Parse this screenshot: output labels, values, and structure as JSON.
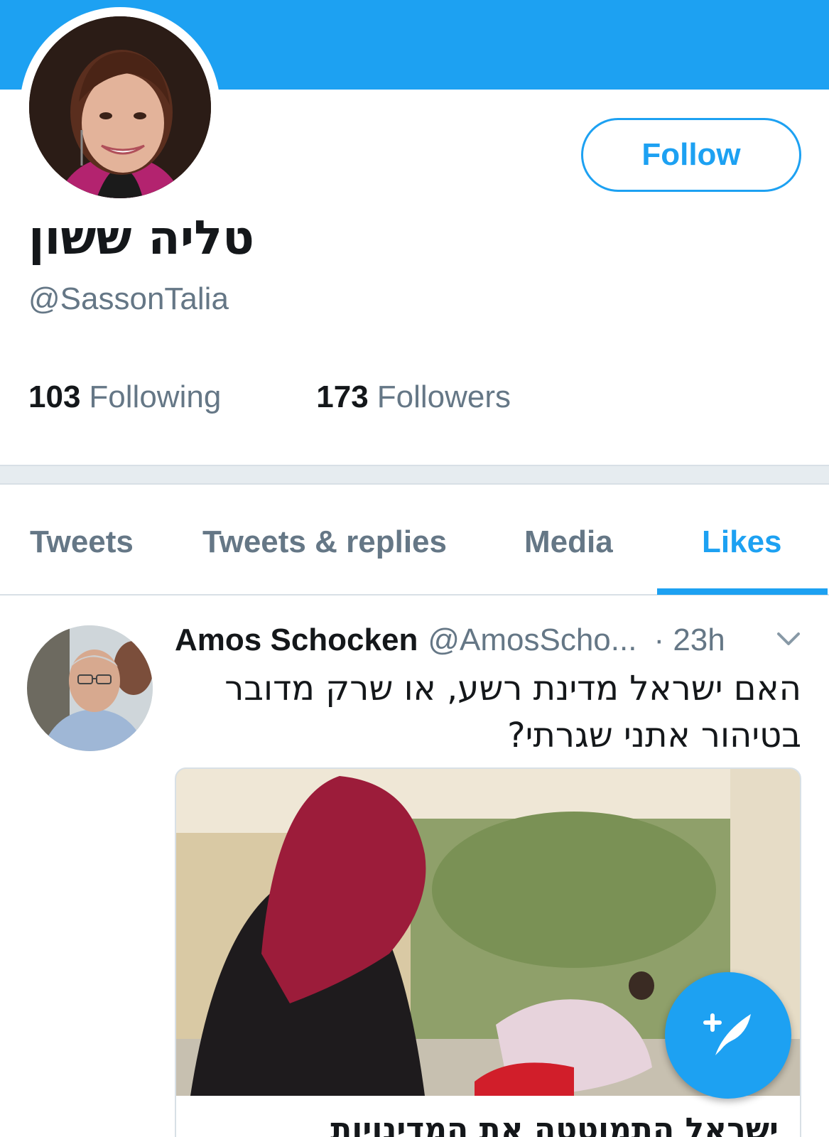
{
  "profile": {
    "display_name": "טליה ששון",
    "handle": "@SassonTalia",
    "follow_label": "Follow",
    "following_count": "103",
    "following_label": "Following",
    "followers_count": "173",
    "followers_label": "Followers"
  },
  "tabs": [
    {
      "label": "Tweets",
      "active": false
    },
    {
      "label": "Tweets & replies",
      "active": false
    },
    {
      "label": "Media",
      "active": false
    },
    {
      "label": "Likes",
      "active": true
    }
  ],
  "tweet": {
    "author": "Amos Schocken",
    "handle": "@AmosScho...",
    "time": "· 23h",
    "text_line1": "האם ישראל מדינת רשע, או שרק מדובר",
    "text_line2": "בטיהור אתני שגרתי?",
    "card_title": "ישראל התמוטטה את המדינויות"
  },
  "icons": {
    "caret": "chevron-down-icon",
    "compose": "compose-tweet-icon"
  },
  "colors": {
    "accent": "#1da1f2",
    "secondary_text": "#657786",
    "primary_text": "#14171a",
    "divider": "#e6ecf0"
  }
}
